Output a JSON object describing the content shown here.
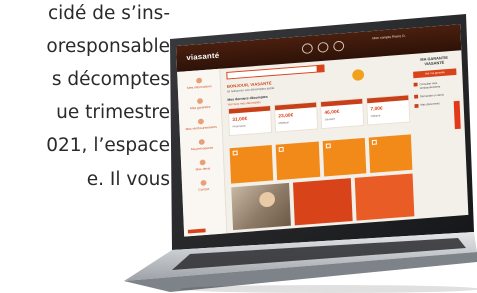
{
  "article": {
    "lines": [
      "cidé de s’ins-",
      "oresponsable",
      "s décomptes",
      "ue trimestre",
      "021, l’espace",
      "e. Il vous"
    ]
  },
  "app": {
    "logo": "viasanté",
    "account_text": "Mon compte\nPierre D.",
    "search_placeholder": "",
    "greeting": "BONJOUR, VIASANTÉ",
    "greeting_sub": "ici retrouvez vos décomptes santé",
    "decomptes_title": "Mes derniers décomptes",
    "decomptes_link": "Voir tous mes décomptes",
    "sidebar_items": [
      "Mes informations",
      "Mes garanties",
      "Mes remboursements",
      "Ma prévoyance",
      "Mes devis",
      "Contact"
    ],
    "stats": [
      {
        "head": "",
        "value": "31,00€",
        "label": "Pharmacie"
      },
      {
        "head": "",
        "value": "23,00€",
        "label": "Médecin"
      },
      {
        "head": "",
        "value": "46,00€",
        "label": "Dentaire"
      },
      {
        "head": "",
        "value": "7,00€",
        "label": "Optique"
      }
    ],
    "tiles": [
      "",
      "",
      "",
      ""
    ],
    "right_title": "MA GARANTIE VIASANTÉ",
    "right_button": "Voir ma garantie",
    "right_links": [
      "Consulter mes remboursements",
      "Demander un devis",
      "Mes documents"
    ]
  },
  "colors": {
    "brand_dark": "#2e1207",
    "brand_orange": "#d9431a",
    "accent_yellow": "#f2a11c",
    "tile_orange": "#f28a1a",
    "laptop_silver": "#c9ccd1"
  }
}
